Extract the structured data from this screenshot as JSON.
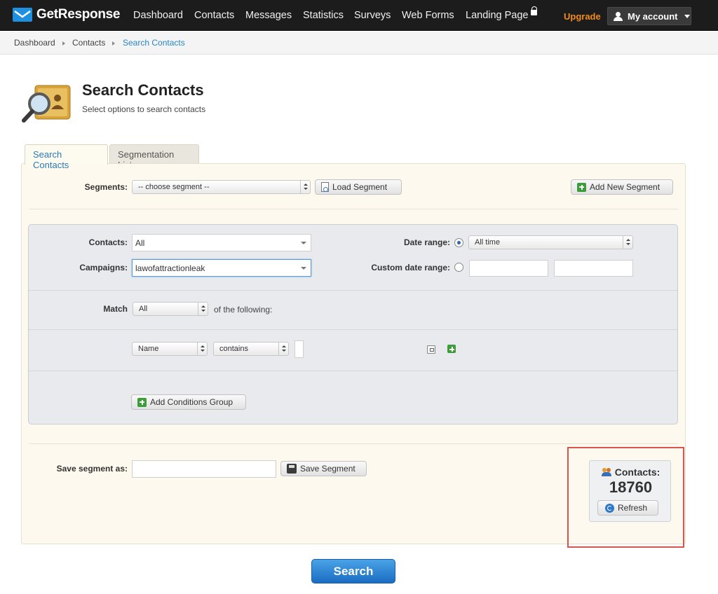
{
  "app": {
    "brand": "GetResponse"
  },
  "nav": {
    "items": [
      "Dashboard",
      "Contacts",
      "Messages",
      "Statistics",
      "Surveys",
      "Web Forms",
      "Landing Page"
    ],
    "upgrade": "Upgrade",
    "account": "My account"
  },
  "breadcrumb": [
    "Dashboard",
    "Contacts",
    "Search Contacts"
  ],
  "header": {
    "title": "Search Contacts",
    "subtitle": "Select options to search contacts"
  },
  "tabs": [
    {
      "label": "Search Contacts",
      "active": true
    },
    {
      "label": "Segmentation List",
      "active": false
    }
  ],
  "segments": {
    "label": "Segments:",
    "selected": "-- choose segment --",
    "load_button": "Load Segment",
    "add_button": "Add New Segment"
  },
  "filters": {
    "contacts_label": "Contacts:",
    "contacts_value": "All",
    "campaigns_label": "Campaigns:",
    "campaigns_value": "lawofattractionleak",
    "date_range_label": "Date range:",
    "date_range_value": "All time",
    "custom_range_label": "Custom date range:",
    "match_label": "Match",
    "match_value": "All",
    "match_suffix": "of the following:",
    "condition_field": "Name",
    "condition_operator": "contains",
    "add_group_button": "Add Conditions Group"
  },
  "save": {
    "label": "Save segment as:",
    "button": "Save Segment"
  },
  "contacts_count": {
    "label": "Contacts:",
    "value": "18760",
    "refresh": "Refresh"
  },
  "search_button": "Search",
  "colors": {
    "topbar": "#1c1c1c",
    "accent_blue": "#2a86c4",
    "upgrade_orange": "#f28c1c",
    "panel_bg": "#fdf9ee",
    "highlight_red": "#d9534f"
  }
}
